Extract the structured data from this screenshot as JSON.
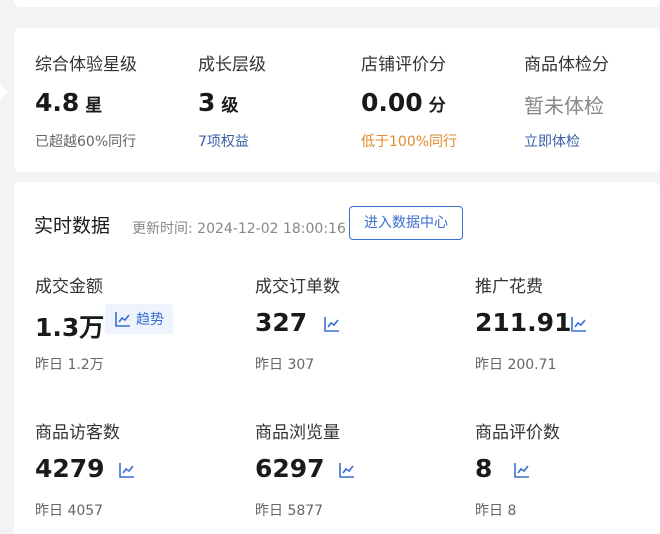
{
  "ratings": [
    {
      "label": "综合体验星级",
      "value": "4.8",
      "unit": "星",
      "sub": "已超越60%同行",
      "sub_color": "gray"
    },
    {
      "label": "成长层级",
      "value": "3",
      "unit": "级",
      "sub": "7项权益",
      "sub_color": "blue"
    },
    {
      "label": "店铺评价分",
      "value": "0.00",
      "unit": "分",
      "sub": "低于100%同行",
      "sub_color": "orange"
    },
    {
      "label": "商品体检分",
      "value_text": "暂未体检",
      "sub": "立即体检",
      "sub_color": "blue"
    }
  ],
  "realtime": {
    "title": "实时数据",
    "updated": "更新时间: 2024-12-02 18:00:16",
    "button": "进入数据中心",
    "trend_label": "趋势",
    "metrics": [
      {
        "label": "成交金额",
        "value": "1.3万",
        "yesterday": "昨日 1.2万"
      },
      {
        "label": "成交订单数",
        "value": "327",
        "yesterday": "昨日 307"
      },
      {
        "label": "推广花费",
        "value": "211.91",
        "yesterday": "昨日 200.71"
      },
      {
        "label": "商品访客数",
        "value": "4279",
        "yesterday": "昨日 4057"
      },
      {
        "label": "商品浏览量",
        "value": "6297",
        "yesterday": "昨日 5877"
      },
      {
        "label": "商品评价数",
        "value": "8",
        "yesterday": "昨日 8"
      }
    ]
  },
  "colors": {
    "accent": "#3a6fd0",
    "orange": "#e08a2b",
    "link_blue": "#3a5fa8"
  },
  "icons": {
    "trend": "trend-line-icon"
  }
}
